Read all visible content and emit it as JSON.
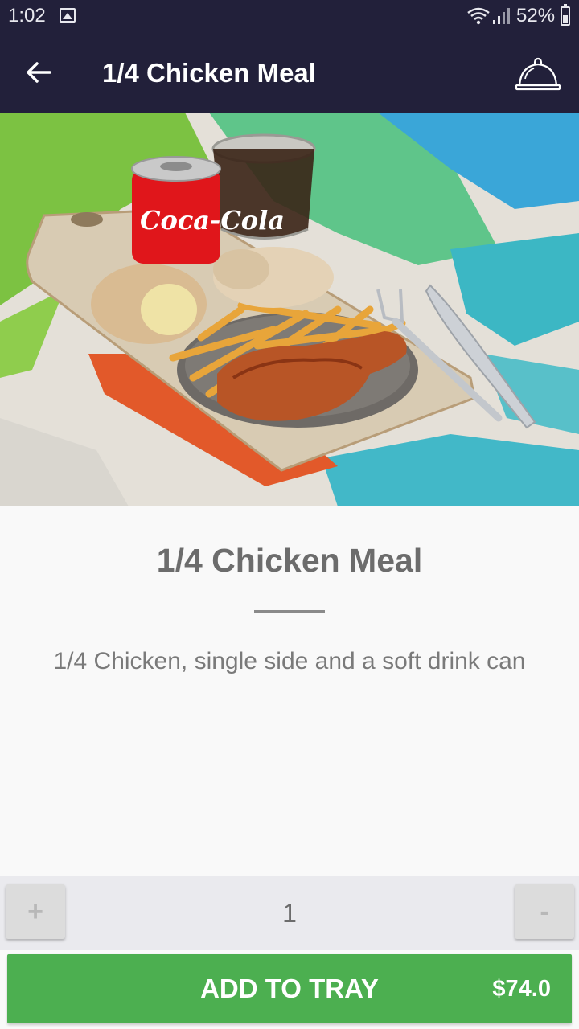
{
  "status_bar": {
    "time": "1:02",
    "battery": "52%"
  },
  "app_bar": {
    "title": "1/4 Chicken Meal"
  },
  "hero": {
    "image": "chicken-meal-photo",
    "can_text": "Coca-Cola"
  },
  "item": {
    "title": "1/4 Chicken Meal",
    "description": "1/4 Chicken, single side and a soft drink can"
  },
  "quantity": {
    "plus_label": "+",
    "value": "1",
    "minus_label": "-"
  },
  "add_to_tray": {
    "label": "ADD TO TRAY",
    "price": "$74.0"
  },
  "colors": {
    "app_bar": "#22203a",
    "add_button": "#4caf50"
  }
}
